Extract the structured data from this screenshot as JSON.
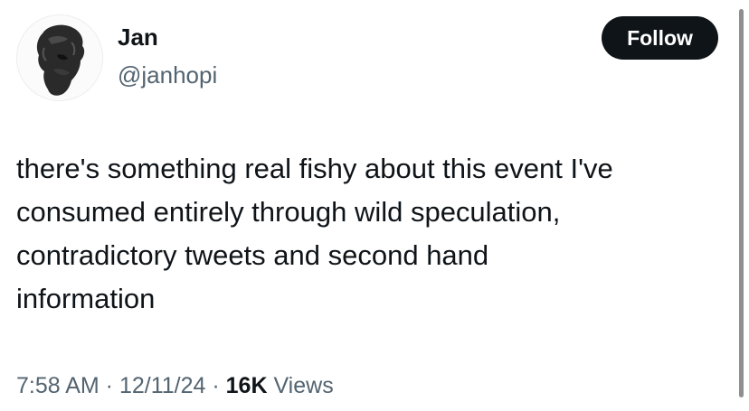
{
  "author": {
    "display_name": "Jan",
    "handle": "@janhopi"
  },
  "follow_button": {
    "label": "Follow"
  },
  "tweet": {
    "text_lines": [
      "there's something real fishy about this event I've",
      "consumed entirely through wild speculation,",
      "contradictory tweets and second hand",
      "information"
    ]
  },
  "meta": {
    "time": "7:58 AM",
    "separator": " · ",
    "date": "12/11/24",
    "views_count": "16K",
    "views_label": " Views"
  },
  "colors": {
    "text_primary": "#0f1419",
    "text_secondary": "#536471",
    "button_bg": "#0f1419",
    "button_text": "#ffffff"
  },
  "icons": {
    "avatar": "sculpture-head-avatar"
  }
}
